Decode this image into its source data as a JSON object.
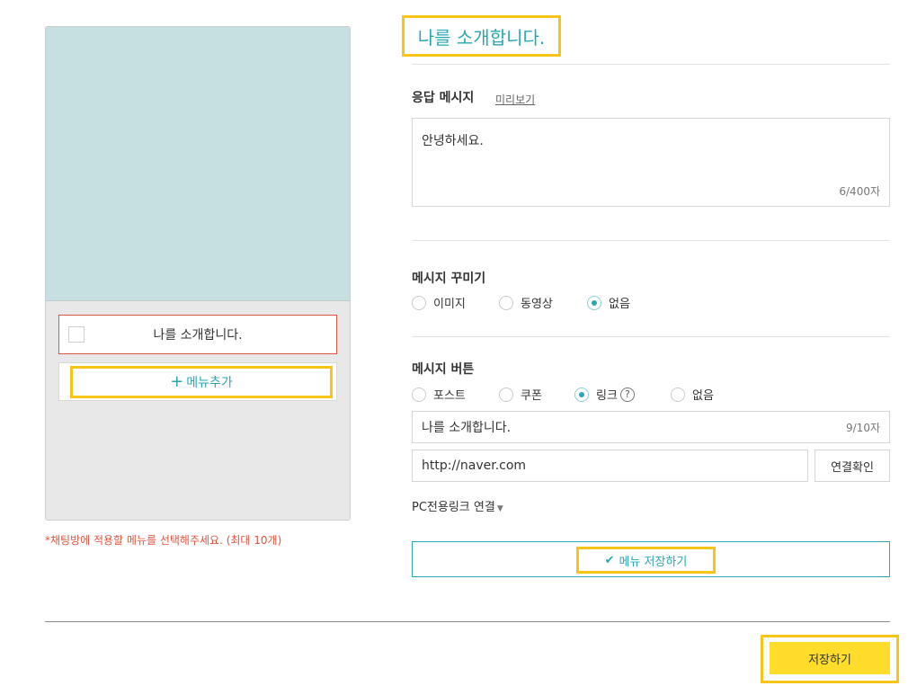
{
  "preview": {
    "menu_item_label": "나를 소개합니다.",
    "add_menu_label": "메뉴추가",
    "notice": "*채팅방에 적용할 메뉴를 선택해주세요. (최대 10개)"
  },
  "form": {
    "title": "나를 소개합니다.",
    "response": {
      "label": "응답 메시지",
      "preview_link": "미리보기",
      "value": "안녕하세요.",
      "counter": "6/400자"
    },
    "decorate": {
      "label": "메시지 꾸미기",
      "options": [
        "이미지",
        "동영상",
        "없음"
      ],
      "selected": "없음"
    },
    "button": {
      "label": "메시지 버튼",
      "options": [
        "포스트",
        "쿠폰",
        "링크",
        "없음"
      ],
      "selected": "링크",
      "help": "?",
      "name_value": "나를 소개합니다.",
      "name_counter": "9/10자",
      "url_value": "http://naver.com",
      "confirm_label": "연결확인",
      "pc_link_label": "PC전용링크 연결"
    },
    "save_menu_label": "메뉴 저장하기"
  },
  "footer": {
    "save_label": "저장하기"
  },
  "colors": {
    "accent": "#2aa7b5",
    "highlight": "#f5c518",
    "save_button": "#ffdd2a",
    "notice": "#e2533e"
  }
}
